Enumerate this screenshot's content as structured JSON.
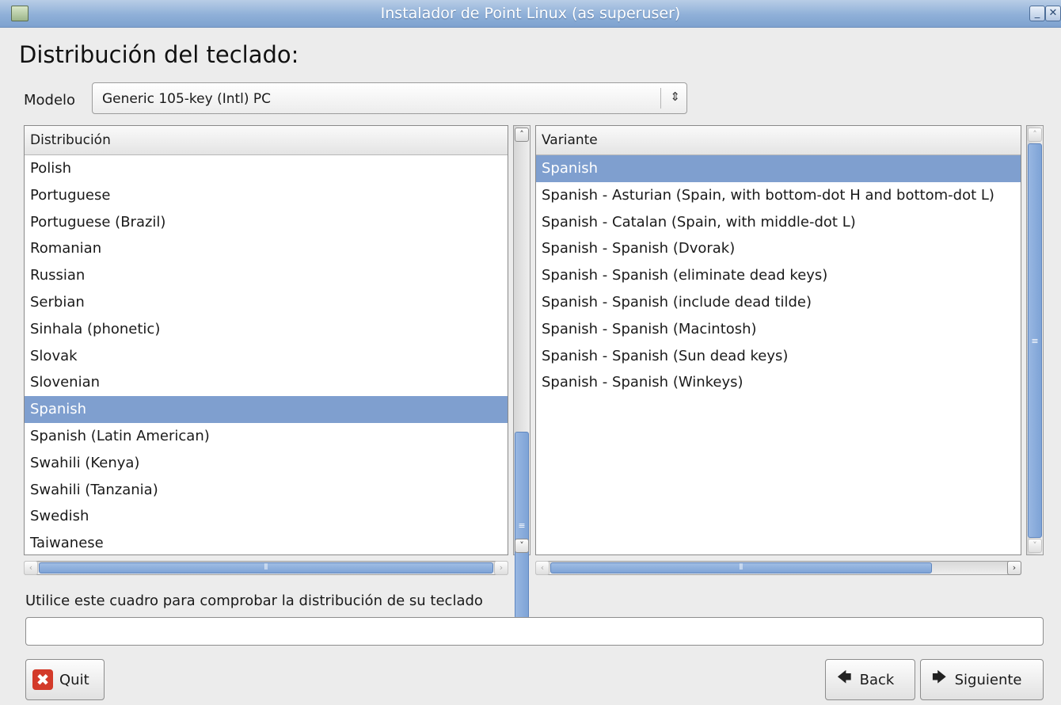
{
  "window": {
    "title": "Instalador de Point Linux (as superuser)",
    "minimize_glyph": "_",
    "close_glyph": "✕"
  },
  "heading": "Distribución del teclado:",
  "model": {
    "label": "Modelo",
    "value": "Generic 105-key (Intl) PC",
    "arrow": "⇕"
  },
  "layout_list": {
    "header": "Distribución",
    "selected": "Spanish",
    "items": [
      "Polish",
      "Portuguese",
      "Portuguese (Brazil)",
      "Romanian",
      "Russian",
      "Serbian",
      "Sinhala (phonetic)",
      "Slovak",
      "Slovenian",
      "Spanish",
      "Spanish (Latin American)",
      "Swahili (Kenya)",
      "Swahili (Tanzania)",
      "Swedish",
      "Taiwanese"
    ]
  },
  "variant_list": {
    "header": "Variante",
    "selected": "Spanish",
    "items": [
      "Spanish",
      "Spanish - Asturian (Spain, with bottom-dot H and bottom-dot L)",
      "Spanish - Catalan (Spain, with middle-dot L)",
      "Spanish - Spanish (Dvorak)",
      "Spanish - Spanish (eliminate dead keys)",
      "Spanish - Spanish (include dead tilde)",
      "Spanish - Spanish (Macintosh)",
      "Spanish - Spanish (Sun dead keys)",
      "Spanish - Spanish (Winkeys)"
    ]
  },
  "scroll": {
    "up": "˄",
    "down": "˅",
    "left": "‹",
    "right": "›",
    "grip_v": "≡",
    "grip_h": "⦀"
  },
  "test": {
    "label": "Utilice este cuadro para comprobar la distribución de su teclado",
    "value": ""
  },
  "buttons": {
    "quit": "Quit",
    "quit_icon": "✖",
    "back": "Back",
    "back_icon": "🡄",
    "next": "Siguiente",
    "next_icon": "🡆"
  }
}
